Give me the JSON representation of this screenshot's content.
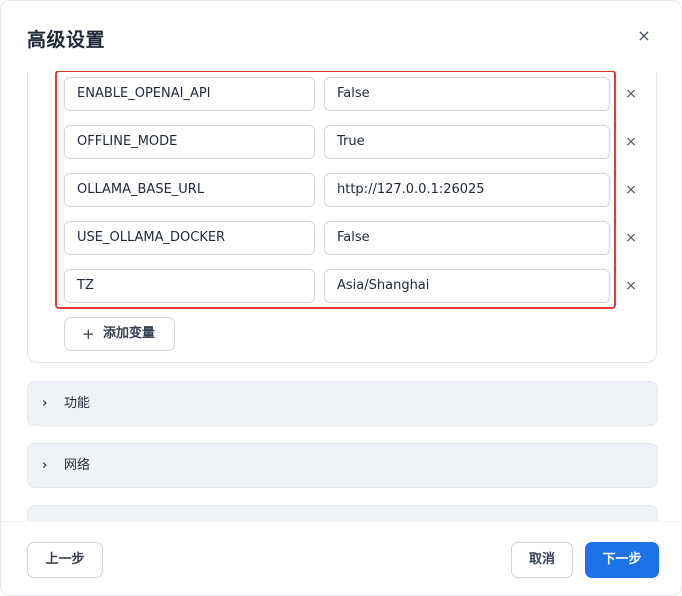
{
  "dialog": {
    "title": "高级设置",
    "close_label": "×"
  },
  "env_vars": [
    {
      "key": "ENABLE_OPENAI_API",
      "value": "False",
      "remove": "×"
    },
    {
      "key": "OFFLINE_MODE",
      "value": "True",
      "remove": "×"
    },
    {
      "key": "OLLAMA_BASE_URL",
      "value": "http://127.0.0.1:26025",
      "remove": "×"
    },
    {
      "key": "USE_OLLAMA_DOCKER",
      "value": "False",
      "remove": "×"
    },
    {
      "key": "TZ",
      "value": "Asia/Shanghai",
      "remove": "×"
    }
  ],
  "add_variable": {
    "plus": "+",
    "label": "添加变量"
  },
  "sections": [
    {
      "chevron": "›",
      "label": "功能"
    },
    {
      "chevron": "›",
      "label": "网络"
    }
  ],
  "footer": {
    "prev_label": "上一步",
    "cancel_label": "取消",
    "next_label": "下一步"
  },
  "colors": {
    "primary": "#1d72e8",
    "highlight": "#e53935",
    "section_bg": "#eff2f7"
  }
}
